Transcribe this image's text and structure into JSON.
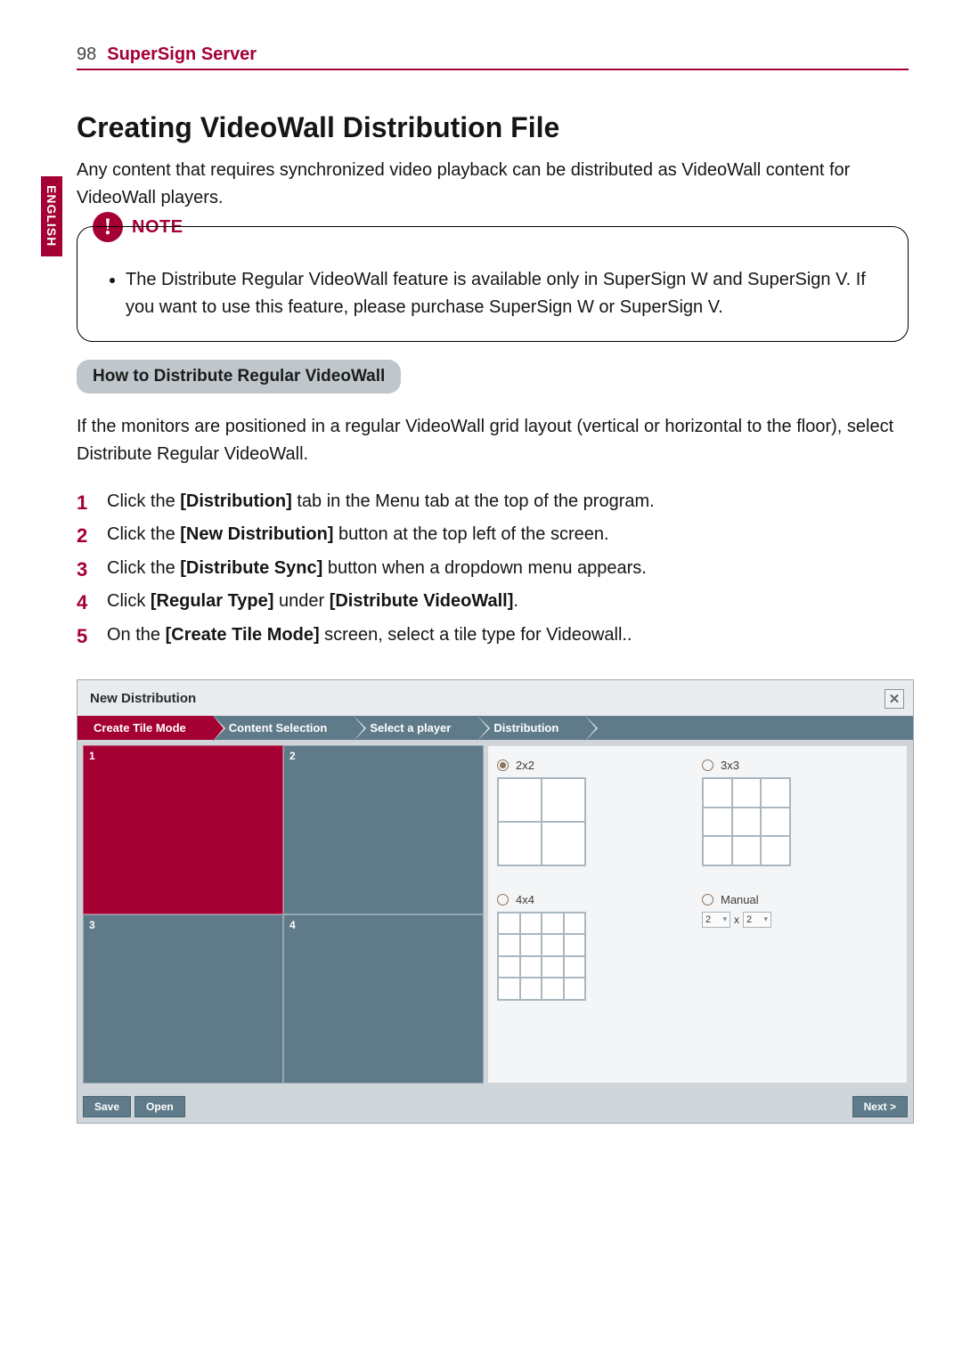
{
  "runner": {
    "page_number": "98",
    "title": "SuperSign Server"
  },
  "sidetab": "ENGLISH",
  "heading": "Creating VideoWall Distribution File",
  "intro": "Any content that requires synchronized video playback can be distributed as VideoWall content for VideoWall players.",
  "note": {
    "label": "NOTE",
    "item": "The Distribute Regular VideoWall feature is available only in SuperSign W and SuperSign V. If you want to use this feature, please purchase SuperSign W or SuperSign V."
  },
  "pill": "How to Distribute Regular VideoWall",
  "pill_desc": "If the monitors are positioned in a regular VideoWall grid layout (vertical or horizontal to the floor), select Distribute Regular VideoWall.",
  "steps": [
    {
      "n": "1",
      "pre": "Click the ",
      "b1": "[Distribution]",
      "post": " tab in the Menu tab at the top of the program."
    },
    {
      "n": "2",
      "pre": "Click the ",
      "b1": "[New Distribution]",
      "post": " button at the top left of the screen."
    },
    {
      "n": "3",
      "pre": "Click the ",
      "b1": "[Distribute Sync]",
      "post": " button when a dropdown menu appears."
    },
    {
      "n": "4",
      "pre": "Click ",
      "b1": "[Regular Type]",
      "mid": " under ",
      "b2": "[Distribute VideoWall]",
      "post": "."
    },
    {
      "n": "5",
      "pre": "On the ",
      "b1": "[Create Tile Mode]",
      "post": " screen, select a tile type for Videowall.."
    }
  ],
  "app": {
    "title": "New Distribution",
    "close_glyph": "✕",
    "wizard": [
      "Create Tile Mode",
      "Content Selection",
      "Select a player",
      "Distribution"
    ],
    "preview_labels": [
      "1",
      "2",
      "3",
      "4"
    ],
    "options": {
      "o1": {
        "label": "2x2",
        "selected": true
      },
      "o2": {
        "label": "3x3",
        "selected": false
      },
      "o3": {
        "label": "4x4",
        "selected": false
      },
      "o4": {
        "label": "Manual",
        "selected": false,
        "a": "2",
        "x": "x",
        "b": "2"
      }
    },
    "buttons": {
      "save": "Save",
      "open": "Open",
      "next": "Next >"
    }
  }
}
